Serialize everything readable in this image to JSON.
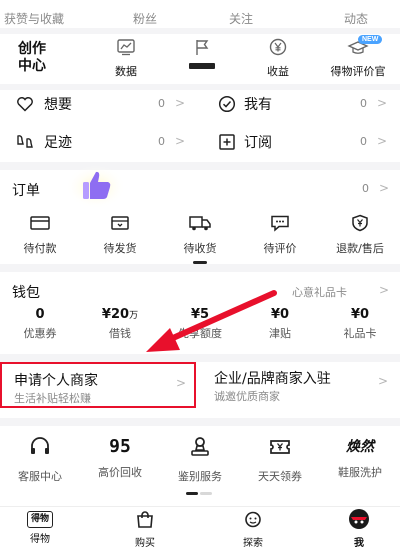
{
  "top_stats": [
    "获赞与收藏",
    "粉丝",
    "关注",
    "动态"
  ],
  "creator": {
    "title_line1": "创作",
    "title_line2": "中心",
    "items": [
      {
        "label": "数据",
        "icon": "chart-icon"
      },
      {
        "label": "",
        "icon": "flag-icon"
      },
      {
        "label": "收益",
        "icon": "yen-circle-icon"
      },
      {
        "label": "得物评价官",
        "icon": "reviewer-hat-icon"
      }
    ],
    "new_badge": "NEW"
  },
  "quick": {
    "want": {
      "label": "想要",
      "count": "0"
    },
    "have": {
      "label": "我有",
      "count": "0"
    },
    "footprint": {
      "label": "足迹",
      "count": "0"
    },
    "subscribe": {
      "label": "订阅",
      "count": "0"
    }
  },
  "orders": {
    "title": "订单",
    "count": "0",
    "items": [
      {
        "label": "待付款",
        "icon": "card-icon"
      },
      {
        "label": "待发货",
        "icon": "box-icon"
      },
      {
        "label": "待收货",
        "icon": "truck-icon"
      },
      {
        "label": "待评价",
        "icon": "comment-icon"
      },
      {
        "label": "退款/售后",
        "icon": "yen-shield-icon"
      }
    ]
  },
  "wallet": {
    "title": "钱包",
    "gift_card_link": "心意礼品卡",
    "items": [
      {
        "value": "0",
        "unit": "",
        "label": "优惠券"
      },
      {
        "value": "¥20",
        "unit": "万",
        "label": "借钱"
      },
      {
        "value": "¥5",
        "unit": "",
        "label": "先享额度"
      },
      {
        "value": "¥0",
        "unit": "",
        "label": "津贴"
      },
      {
        "value": "¥0",
        "unit": "",
        "label": "礼品卡"
      }
    ]
  },
  "merchant": {
    "personal": {
      "title": "申请个人商家",
      "subtitle": "生活补贴轻松赚"
    },
    "enterprise": {
      "title": "企业/品牌商家入驻",
      "subtitle": "诚邀优质商家"
    }
  },
  "services": [
    {
      "label": "客服中心",
      "icon": "headset-icon",
      "glyph": ""
    },
    {
      "label": "高价回收",
      "icon": "recycle-95-icon",
      "glyph": "95"
    },
    {
      "label": "鉴别服务",
      "icon": "stamp-icon",
      "glyph": ""
    },
    {
      "label": "天天领券",
      "icon": "coupon-icon",
      "glyph": ""
    },
    {
      "label": "鞋服洗护",
      "icon": "wash-logo-icon",
      "glyph": "焕然"
    }
  ],
  "tabbar": [
    {
      "label": "得物",
      "icon_text": "得物"
    },
    {
      "label": "购买",
      "icon_text": ""
    },
    {
      "label": "探索",
      "icon_text": ""
    },
    {
      "label": "我",
      "icon_text": ""
    }
  ],
  "colors": {
    "accent_red": "#e8102c",
    "badge_blue": "#4aa3ff"
  }
}
